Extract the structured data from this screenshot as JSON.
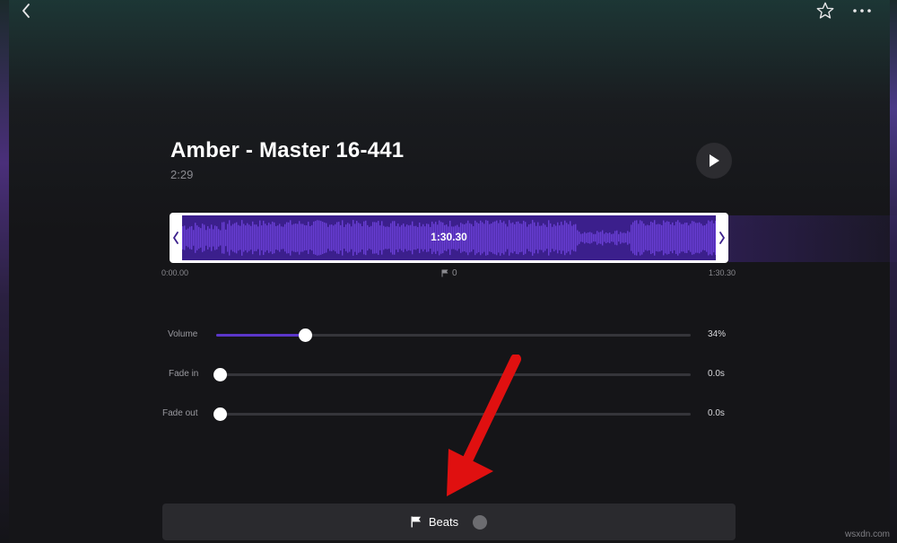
{
  "nav": {
    "back_icon": "chevron-left-icon",
    "favorite_icon": "star-outline-icon",
    "more_icon": "ellipsis-icon"
  },
  "track": {
    "title": "Amber - Master 16-441",
    "duration": "2:29",
    "selection_length": "1:30.30",
    "start_time": "0:00.00",
    "end_time": "1:30.30",
    "beat_marker_count": "0"
  },
  "settings": {
    "volume": {
      "label": "Volume",
      "value_text": "34%",
      "level": 0.18
    },
    "fade_in": {
      "label": "Fade in",
      "value_text": "0.0s",
      "level": 0
    },
    "fade_out": {
      "label": "Fade out",
      "value_text": "0.0s",
      "level": 0
    }
  },
  "beats": {
    "label": "Beats",
    "enabled": false
  },
  "watermark": "wsxdn.com",
  "colors": {
    "accent": "#5b36c9",
    "waveform": "#6a3fd6",
    "annotation_arrow": "#e01010"
  }
}
